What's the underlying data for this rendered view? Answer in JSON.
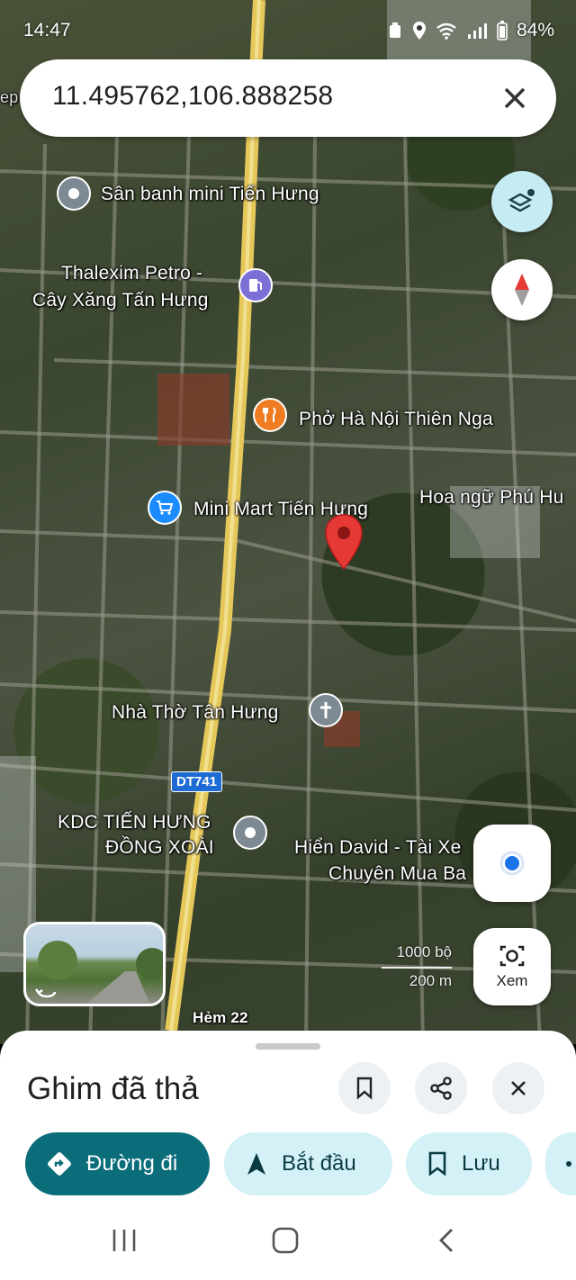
{
  "status_bar": {
    "time": "14:47",
    "battery": "84%"
  },
  "search": {
    "query": "11.495762,106.888258"
  },
  "map": {
    "pois": [
      {
        "name": "Sân banh mini Tiến Hưng",
        "icon": "location-icon"
      },
      {
        "name": "Thalexim Petro -",
        "name2": "Cây Xăng Tấn Hưng",
        "icon": "gas-station-icon"
      },
      {
        "name": "Phở Hà Nội Thiên Nga",
        "icon": "restaurant-icon"
      },
      {
        "name": "Mini Mart Tiến Hưng",
        "icon": "shopping-cart-icon"
      },
      {
        "name": "Hoa ngữ Phú Hu",
        "icon": ""
      },
      {
        "name": "Nhà Thờ Tân Hưng",
        "icon": "church-cross-icon"
      },
      {
        "name": "KDC TIẾN HƯNG",
        "name2": "ĐỒNG XOÀI",
        "icon": "location-icon"
      },
      {
        "name": "Hiển David - Tài Xe",
        "name2": "Chuyên Mua Ba",
        "icon": ""
      }
    ],
    "road_badge": "DT741",
    "road_label": "Hẻm 22",
    "edge_label": "ep",
    "scale": {
      "imperial": "1000 bộ",
      "metric": "200 m"
    }
  },
  "controls": {
    "view_label": "Xem"
  },
  "sheet": {
    "title": "Ghim đã thả",
    "chips": [
      {
        "label": "Đường đi",
        "icon": "directions-icon"
      },
      {
        "label": "Bắt đầu",
        "icon": "navigation-arrow-icon"
      },
      {
        "label": "Lưu",
        "icon": "bookmark-icon"
      }
    ]
  },
  "colors": {
    "primary": "#0b6d7a",
    "tonal": "#d3f1f6",
    "pin": "#e53935",
    "road": "#e6c85a"
  }
}
